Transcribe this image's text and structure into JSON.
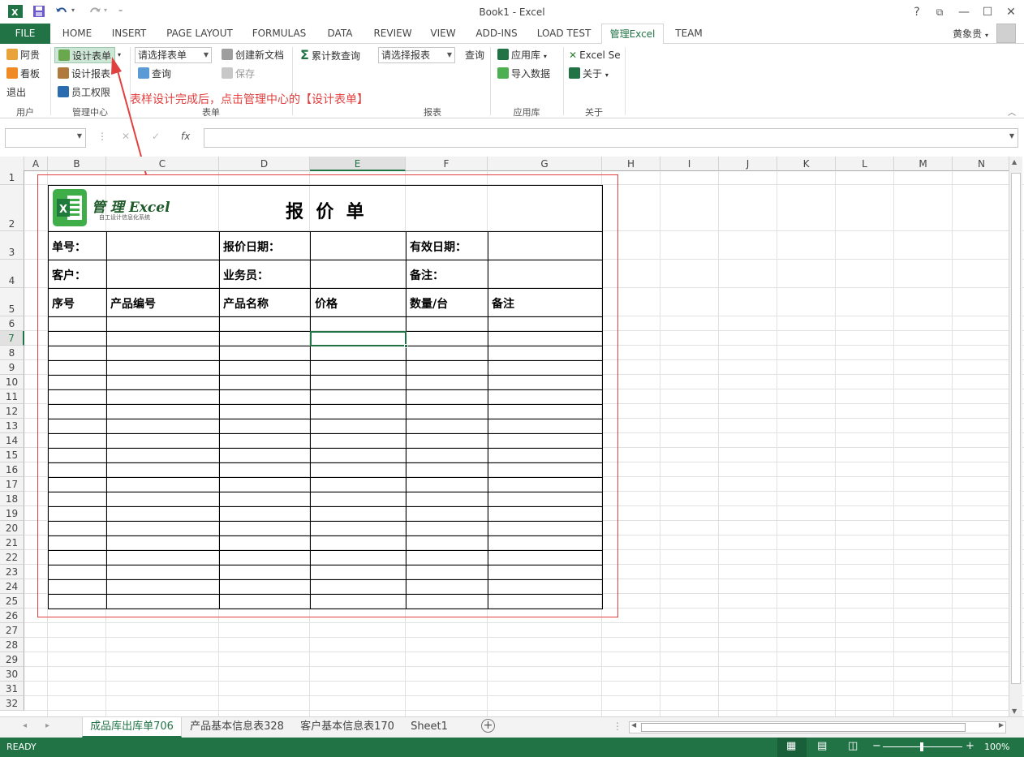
{
  "window": {
    "title": "Book1 - Excel",
    "help": "?",
    "restore": "⧉",
    "minimize": "—",
    "maximize": "☐",
    "close": "✕",
    "user": "黄象贵"
  },
  "qat": {
    "excel_icon": "excel-logo-icon",
    "save": "save-icon",
    "undo": "undo-icon",
    "redo": "redo-icon"
  },
  "tabs": [
    "FILE",
    "HOME",
    "INSERT",
    "PAGE LAYOUT",
    "FORMULAS",
    "DATA",
    "REVIEW",
    "VIEW",
    "ADD-INS",
    "LOAD TEST",
    "管理Excel",
    "TEAM"
  ],
  "ribbon": {
    "user_group": {
      "label": "用户",
      "items": [
        "阿贵",
        "看板",
        "退出"
      ]
    },
    "admin_group": {
      "label": "管理中心",
      "items": [
        "设计表单",
        "设计报表",
        "员工权限"
      ]
    },
    "form_group": {
      "label": "表单",
      "select_placeholder": "请选择表单",
      "query": "查询",
      "create_new": "创建新文档",
      "save": "保存"
    },
    "report_group": {
      "label": "报表",
      "cumulative_query": "累计数查询",
      "select_placeholder": "请选择报表",
      "query": "查询"
    },
    "applib_group": {
      "label": "应用库",
      "applib": "应用库",
      "import": "导入数据"
    },
    "about_group": {
      "label": "关于",
      "excel_se": "Excel Se",
      "about": "关于"
    }
  },
  "formula_bar": {
    "cancel": "✕",
    "enter": "✓",
    "fx": "fx",
    "name_box": "",
    "value": ""
  },
  "annotation": "表样设计完成后，点击管理中心的【设计表单】",
  "columns": [
    "A",
    "B",
    "C",
    "D",
    "E",
    "F",
    "G",
    "H",
    "I",
    "J",
    "K",
    "L",
    "M",
    "N"
  ],
  "rows": [
    "1",
    "2",
    "3",
    "4",
    "5",
    "6",
    "7",
    "8",
    "9",
    "10",
    "11",
    "12",
    "13",
    "14",
    "15",
    "16",
    "17",
    "18",
    "19",
    "20",
    "21",
    "22",
    "23",
    "24",
    "25",
    "26",
    "27",
    "28",
    "29",
    "30",
    "31",
    "32"
  ],
  "quote": {
    "logo_text": "管 理 Excel",
    "logo_sub": "自工设计信息化系统",
    "title": "报  价  单",
    "order_no": "单号：",
    "quote_date": "报价日期：",
    "valid_date": "有效日期：",
    "customer": "客户：",
    "salesperson": "业务员：",
    "remark": "备注：",
    "headers": [
      "序号",
      "产品编号",
      "产品名称",
      "价格",
      "数量/台",
      "备注"
    ]
  },
  "sheets": [
    "成品库出库单706",
    "产品基本信息表328",
    "客户基本信息表170",
    "Sheet1"
  ],
  "status": {
    "ready": "READY",
    "zoom": "100%",
    "minus": "−",
    "plus": "+"
  },
  "colors": {
    "excel_green": "#217346",
    "annotation_red": "#e0403f"
  }
}
